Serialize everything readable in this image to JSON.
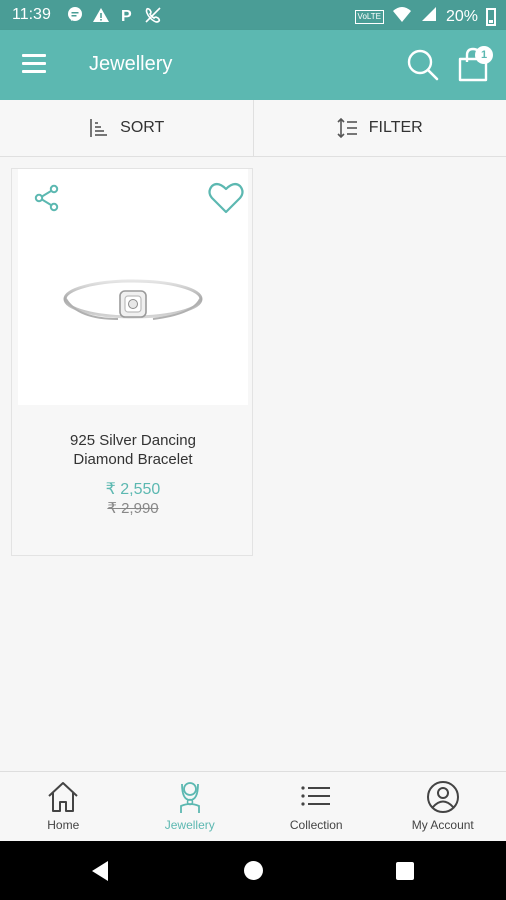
{
  "status_bar": {
    "time": "11:39",
    "left_icons": [
      "message-icon",
      "alert-icon",
      "parking-icon",
      "phone-icon"
    ],
    "volte": "VoLTE",
    "battery": "20%"
  },
  "app_bar": {
    "title": "Jewellery",
    "cart_count": "1"
  },
  "toolbar": {
    "sort_label": "SORT",
    "filter_label": "FILTER"
  },
  "products": [
    {
      "name_line1": "925 Silver Dancing",
      "name_line2": "Diamond Bracelet",
      "price": "₹ 2,550",
      "mrp": "₹ 2,990"
    }
  ],
  "bottom_nav": {
    "items": [
      {
        "label": "Home",
        "icon": "home-icon"
      },
      {
        "label": "Jewellery",
        "icon": "jewellery-icon"
      },
      {
        "label": "Collection",
        "icon": "list-icon"
      },
      {
        "label": "My Account",
        "icon": "account-icon"
      }
    ],
    "active": "Jewellery"
  },
  "colors": {
    "primary": "#5cb8b1",
    "status_bar": "#4a9d96",
    "background": "#f6f6f6"
  }
}
